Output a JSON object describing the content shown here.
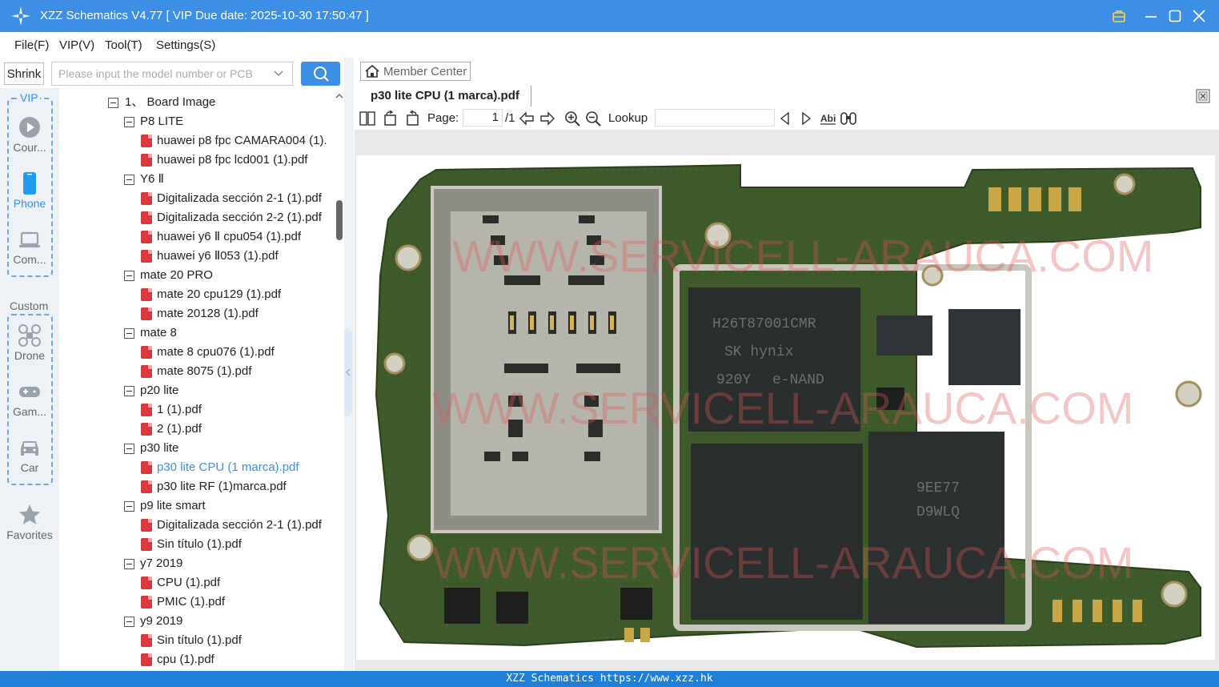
{
  "window": {
    "title": "XZZ Schematics V4.77 [ VIP Due date: 2025-10-30 17:50:47 ]",
    "accent": "#3d8fe6"
  },
  "menu": [
    "File(F)",
    "VIP(V)",
    "Tool(T)",
    "Settings(S)"
  ],
  "search": {
    "shrink_label": "Shrink",
    "placeholder": "Please input the model number or PCB"
  },
  "sidebar": {
    "vip_label": "VIP",
    "custom_label": "Custom",
    "items": [
      {
        "label": "Cour...",
        "icon": "play-circle-icon"
      },
      {
        "label": "Phone",
        "icon": "phone-icon",
        "active": true
      },
      {
        "label": "Com...",
        "icon": "laptop-icon"
      },
      {
        "label": "Drone",
        "icon": "drone-icon"
      },
      {
        "label": "Gam...",
        "icon": "gamepad-icon"
      },
      {
        "label": "Car",
        "icon": "car-icon"
      },
      {
        "label": "Favorites",
        "icon": "star-icon"
      }
    ]
  },
  "tree": {
    "root": "1、 Board Image",
    "groups": [
      {
        "name": "P8 LITE",
        "files": [
          "huawei p8 fpc CAMARA004 (1).",
          "huawei p8 fpc lcd001 (1).pdf"
        ]
      },
      {
        "name": "Y6 Ⅱ",
        "files": [
          "Digitalizada sección 2-1 (1).pdf",
          "Digitalizada sección 2-2 (1).pdf",
          "huawei y6 Ⅱ cpu054 (1).pdf",
          "huawei y6 Ⅱ053 (1).pdf"
        ]
      },
      {
        "name": "mate 20 PRO",
        "files": [
          "mate 20 cpu129 (1).pdf",
          "mate 20128 (1).pdf"
        ]
      },
      {
        "name": "mate 8",
        "files": [
          "mate 8 cpu076 (1).pdf",
          "mate 8075 (1).pdf"
        ]
      },
      {
        "name": "p20 lite",
        "files": [
          "1 (1).pdf",
          "2 (1).pdf"
        ]
      },
      {
        "name": "p30 lite",
        "files": [
          "p30 lite CPU (1 marca).pdf",
          "p30 lite RF (1)marca.pdf"
        ]
      },
      {
        "name": "p9 lite smart",
        "files": [
          "Digitalizada sección 2-1 (1).pdf",
          "Sin título (1).pdf"
        ]
      },
      {
        "name": "y7 2019",
        "files": [
          "CPU (1).pdf",
          "PMIC (1).pdf"
        ]
      },
      {
        "name": "y9 2019",
        "files": [
          "Sin título (1).pdf",
          "cpu (1).pdf"
        ]
      }
    ],
    "selected": "p30 lite CPU (1 marca).pdf"
  },
  "viewer": {
    "member_center": "Member Center",
    "doc_tab": "p30 lite CPU (1 marca).pdf",
    "page_label": "Page:",
    "page_current": "1",
    "page_total": "/1",
    "lookup_label": "Lookup",
    "lookup_value": "",
    "watermark": "WWW.SERVICELL-ARAUCA.COM",
    "board_text": {
      "chip1": [
        "H26T87001CMR",
        "SK hynix",
        "e-NAND",
        "920Y"
      ],
      "chip3": [
        "9EE77",
        "D9WLQ"
      ]
    }
  },
  "status": "XZZ Schematics https://www.xzz.hk"
}
